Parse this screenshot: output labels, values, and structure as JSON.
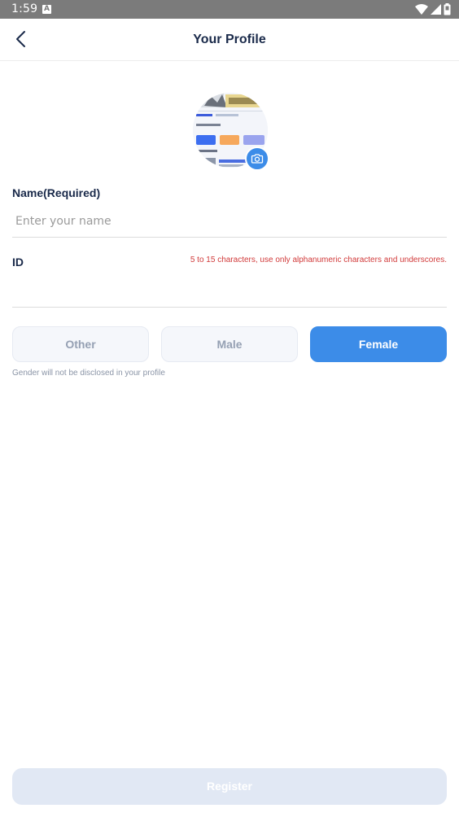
{
  "status_bar": {
    "time": "1:59",
    "notification_icon": "a-badge-icon",
    "icons": [
      "wifi-icon",
      "signal-icon",
      "battery-icon"
    ]
  },
  "header": {
    "title": "Your Profile",
    "back_icon": "chevron-left-icon"
  },
  "avatar": {
    "camera_icon": "camera-icon"
  },
  "name_field": {
    "label": "Name(Required)",
    "placeholder": "Enter your name",
    "value": ""
  },
  "id_field": {
    "label": "ID",
    "hint": "5 to 15 characters, use only alphanumeric characters and underscores.",
    "value": ""
  },
  "gender": {
    "options": [
      "Other",
      "Male",
      "Female"
    ],
    "selected": "Female",
    "note": "Gender will not be disclosed in your profile"
  },
  "register": {
    "label": "Register",
    "enabled": false
  },
  "colors": {
    "accent": "#3c8ce8",
    "hint_error": "#d13a3a",
    "title_text": "#1a2a4a",
    "disabled_button": "#e1e8f4"
  }
}
